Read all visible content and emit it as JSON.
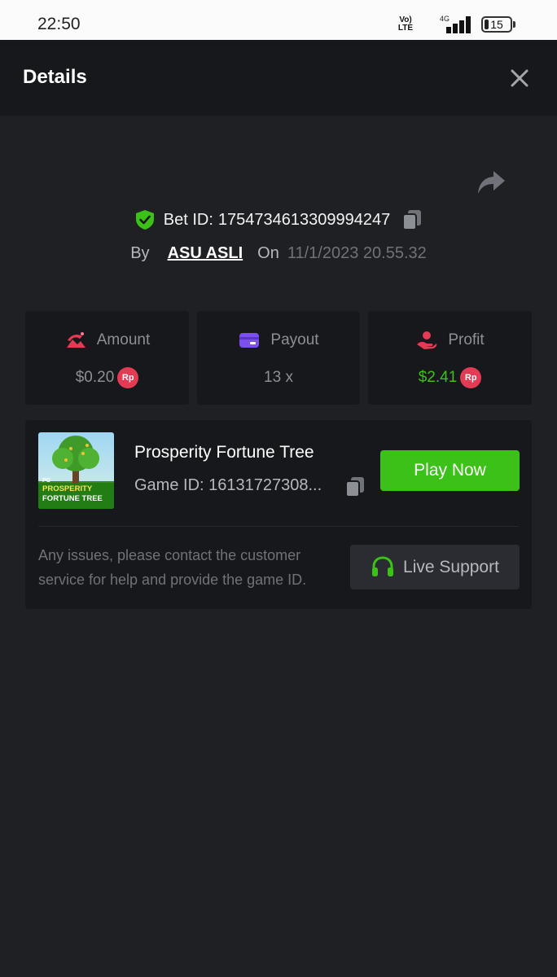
{
  "status_bar": {
    "time": "22:50",
    "volte_top": "Vo)",
    "volte_bottom": "LTE",
    "network": "4G",
    "battery": "15"
  },
  "header": {
    "title": "Details"
  },
  "bet": {
    "id_label": "Bet ID:",
    "id_value": "1754734613309994247",
    "by_label": "By",
    "username": "ASU ASLI",
    "on_label": "On",
    "date": "11/1/2023 20.55.32"
  },
  "stats": {
    "amount": {
      "label": "Amount",
      "value": "$0.20",
      "badge": "Rp"
    },
    "payout": {
      "label": "Payout",
      "value": "13 x"
    },
    "profit": {
      "label": "Profit",
      "value": "$2.41",
      "badge": "Rp"
    }
  },
  "game": {
    "name": "Prosperity Fortune Tree",
    "id_text": "Game ID: 16131727308...",
    "thumb_brand": "PG",
    "thumb_line1": "PROSPERITY",
    "thumb_line2": "FORTUNE TREE",
    "play_label": "Play Now"
  },
  "support": {
    "text": "Any issues, please contact the customer service for help and provide the game ID.",
    "button_label": "Live Support"
  },
  "colors": {
    "background": "#1f2024",
    "panel": "#17181c",
    "accent_green": "#3bc117",
    "badge_red": "#e33b53",
    "payout_purple": "#7b4ff0"
  }
}
